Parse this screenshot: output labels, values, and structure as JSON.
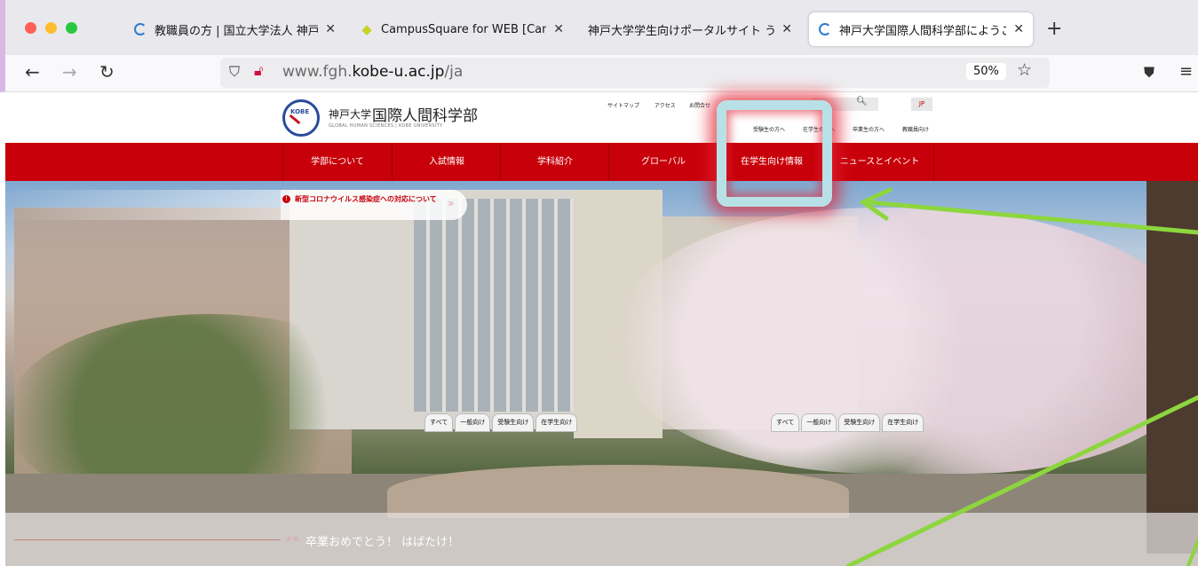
{
  "browser": {
    "tabs": [
      {
        "title": "教職員の方 | 国立大学法人 神戸大学",
        "close": "✕",
        "favicon": "spinner-icon"
      },
      {
        "title": "CampusSquare for WEB [Campus",
        "close": "✕",
        "favicon": "leaf-icon"
      },
      {
        "title": "神戸大学学生向けポータルサイト うり",
        "close": "✕",
        "favicon": "none"
      },
      {
        "title": "神戸大学国際人間科学部にようこそ",
        "close": "✕",
        "favicon": "spinner-icon"
      }
    ],
    "new_tab": "+",
    "back": "←",
    "forward": "→",
    "reload": "↻",
    "url_prefix": "www.fgh.",
    "url_domain": "kobe-u.ac.jp",
    "url_path": "/ja",
    "zoom": "50%",
    "bookmark": "☆",
    "menu": "≡"
  },
  "site": {
    "logo_mark": "KOBE",
    "university": "神戸大学",
    "faculty": "国際人間科学部",
    "subtitle": "GLOBAL HUMAN SCIENCES | KOBE UNIVERSITY",
    "utility_links": [
      "サイトマップ",
      "アクセス",
      "お問合せ"
    ],
    "language": "JP",
    "audience_links": [
      "受験生の方へ",
      "在学生の方へ",
      "卒業生の方へ",
      "教職員向け"
    ],
    "global_nav": [
      "学部について",
      "入試情報",
      "学科紹介",
      "グローバル",
      "在学生向け情報",
      "ニュースとイベント"
    ],
    "notice": {
      "text": "新型コロナウイルス感染症への対応について",
      "arrow": "»"
    },
    "filters": [
      "すべて",
      "一般向け",
      "受験生向け",
      "在学生向け"
    ],
    "news": {
      "arrow": "»»",
      "text": "卒業おめでとう！ はばたけ！"
    }
  },
  "annotation": {
    "highlight_color": "#b7e1e6",
    "glow_color": "#e22030",
    "arrow_color": "#8dd63e"
  }
}
